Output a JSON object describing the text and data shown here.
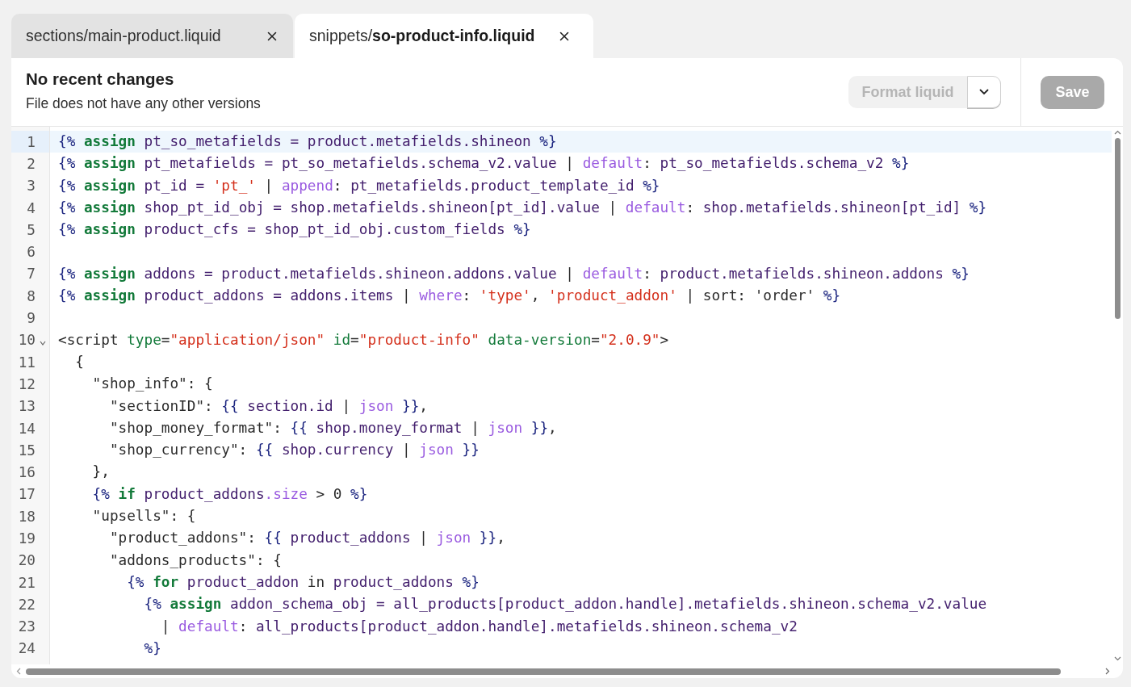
{
  "tabs": [
    {
      "label": "sections/main-product.liquid",
      "selected": false
    },
    {
      "label": "snippets/**so-product-info.liquid**",
      "selected": true
    }
  ],
  "header": {
    "title": "No recent changes",
    "subtitle": "File does not have any other versions"
  },
  "format_button": {
    "label": "Format liquid",
    "disabled": true
  },
  "save_button": {
    "label": "Save",
    "disabled": true
  },
  "lines": [
    {
      "number": "1",
      "active": true,
      "foldable": false,
      "tokens": [
        {
          "text": "{% ",
          "kind": "delim"
        },
        {
          "text": "assign",
          "kind": "keyword"
        },
        {
          "text": " pt_so_metafields = product.metafields.shineon ",
          "kind": "variable"
        },
        {
          "text": "%}",
          "kind": "delim"
        }
      ]
    },
    {
      "number": "2",
      "active": false,
      "foldable": false,
      "tokens": [
        {
          "text": "{% ",
          "kind": "delim"
        },
        {
          "text": "assign",
          "kind": "keyword"
        },
        {
          "text": " pt_metafields = pt_so_metafields.schema_v2.value ",
          "kind": "variable"
        },
        {
          "text": "| ",
          "kind": "plain"
        },
        {
          "text": "default",
          "kind": "filter"
        },
        {
          "text": ": ",
          "kind": "plain"
        },
        {
          "text": "pt_so_metafields.schema_v2 ",
          "kind": "variable"
        },
        {
          "text": "%}",
          "kind": "delim"
        }
      ]
    },
    {
      "number": "3",
      "active": false,
      "foldable": false,
      "tokens": [
        {
          "text": "{% ",
          "kind": "delim"
        },
        {
          "text": "assign",
          "kind": "keyword"
        },
        {
          "text": " pt_id = ",
          "kind": "variable"
        },
        {
          "text": "'pt_'",
          "kind": "string"
        },
        {
          "text": " | ",
          "kind": "plain"
        },
        {
          "text": "append",
          "kind": "filter"
        },
        {
          "text": ": ",
          "kind": "plain"
        },
        {
          "text": "pt_metafields.product_template_id ",
          "kind": "variable"
        },
        {
          "text": "%}",
          "kind": "delim"
        }
      ]
    },
    {
      "number": "4",
      "active": false,
      "foldable": false,
      "tokens": [
        {
          "text": "{% ",
          "kind": "delim"
        },
        {
          "text": "assign",
          "kind": "keyword"
        },
        {
          "text": " shop_pt_id_obj = shop.metafields.shineon[pt_id].value ",
          "kind": "variable"
        },
        {
          "text": "| ",
          "kind": "plain"
        },
        {
          "text": "default",
          "kind": "filter"
        },
        {
          "text": ": ",
          "kind": "plain"
        },
        {
          "text": "shop.metafields.shineon[pt_id] ",
          "kind": "variable"
        },
        {
          "text": "%}",
          "kind": "delim"
        }
      ]
    },
    {
      "number": "5",
      "active": false,
      "foldable": false,
      "tokens": [
        {
          "text": "{% ",
          "kind": "delim"
        },
        {
          "text": "assign",
          "kind": "keyword"
        },
        {
          "text": " product_cfs = shop_pt_id_obj.custom_fields ",
          "kind": "variable"
        },
        {
          "text": "%}",
          "kind": "delim"
        }
      ]
    },
    {
      "number": "6",
      "active": false,
      "foldable": false
    },
    {
      "number": "7",
      "active": false,
      "foldable": false,
      "tokens": [
        {
          "text": "{% ",
          "kind": "delim"
        },
        {
          "text": "assign",
          "kind": "keyword"
        },
        {
          "text": " addons = product.metafields.shineon.addons.value ",
          "kind": "variable"
        },
        {
          "text": "| ",
          "kind": "plain"
        },
        {
          "text": "default",
          "kind": "filter"
        },
        {
          "text": ": ",
          "kind": "plain"
        },
        {
          "text": "product.metafields.shineon.addons ",
          "kind": "variable"
        },
        {
          "text": "%}",
          "kind": "delim"
        }
      ]
    },
    {
      "number": "8",
      "active": false,
      "foldable": false,
      "tokens": [
        {
          "text": "{% ",
          "kind": "delim"
        },
        {
          "text": "assign",
          "kind": "keyword"
        },
        {
          "text": " product_addons = addons.items ",
          "kind": "variable"
        },
        {
          "text": "| ",
          "kind": "plain"
        },
        {
          "text": "where",
          "kind": "filter"
        },
        {
          "text": ": ",
          "kind": "plain"
        },
        {
          "text": "'type'",
          "kind": "string"
        },
        {
          "text": ", ",
          "kind": "plain"
        },
        {
          "text": "'product_addon'",
          "kind": "string"
        },
        {
          "text": " | sort: 'order' ",
          "kind": "plain"
        },
        {
          "text": "%}",
          "kind": "delim"
        }
      ]
    },
    {
      "number": "9",
      "active": false,
      "foldable": false
    },
    {
      "number": "10",
      "active": false,
      "foldable": true,
      "tokens": [
        {
          "text": "<script ",
          "kind": "plain"
        },
        {
          "text": "type",
          "kind": "attr"
        },
        {
          "text": "=",
          "kind": "plain"
        },
        {
          "text": "\"application/json\"",
          "kind": "string"
        },
        {
          "text": " id",
          "kind": "attr"
        },
        {
          "text": "=",
          "kind": "plain"
        },
        {
          "text": "\"product-info\"",
          "kind": "string"
        },
        {
          "text": " data-version",
          "kind": "attr"
        },
        {
          "text": "=",
          "kind": "plain"
        },
        {
          "text": "\"2.0.9\"",
          "kind": "string"
        },
        {
          "text": ">",
          "kind": "plain"
        }
      ]
    },
    {
      "number": "11",
      "active": false,
      "foldable": false,
      "tokens": [
        {
          "text": "  {",
          "kind": "plain"
        }
      ]
    },
    {
      "number": "12",
      "active": false,
      "foldable": false,
      "tokens": [
        {
          "text": "    \"shop_info\": {",
          "kind": "plain"
        }
      ]
    },
    {
      "number": "13",
      "active": false,
      "foldable": false,
      "tokens": [
        {
          "text": "      \"sectionID\": ",
          "kind": "plain"
        },
        {
          "text": "{{ ",
          "kind": "delim"
        },
        {
          "text": "section.id ",
          "kind": "variable"
        },
        {
          "text": "| ",
          "kind": "plain"
        },
        {
          "text": "json",
          "kind": "filter"
        },
        {
          "text": " }}",
          "kind": "delim"
        },
        {
          "text": ",",
          "kind": "plain"
        }
      ]
    },
    {
      "number": "14",
      "active": false,
      "foldable": false,
      "tokens": [
        {
          "text": "      \"shop_money_format\": ",
          "kind": "plain"
        },
        {
          "text": "{{ ",
          "kind": "delim"
        },
        {
          "text": "shop.money_format ",
          "kind": "variable"
        },
        {
          "text": "| ",
          "kind": "plain"
        },
        {
          "text": "json",
          "kind": "filter"
        },
        {
          "text": " }}",
          "kind": "delim"
        },
        {
          "text": ",",
          "kind": "plain"
        }
      ]
    },
    {
      "number": "15",
      "active": false,
      "foldable": false,
      "tokens": [
        {
          "text": "      \"shop_currency\": ",
          "kind": "plain"
        },
        {
          "text": "{{ ",
          "kind": "delim"
        },
        {
          "text": "shop.currency ",
          "kind": "variable"
        },
        {
          "text": "| ",
          "kind": "plain"
        },
        {
          "text": "json",
          "kind": "filter"
        },
        {
          "text": " }}",
          "kind": "delim"
        }
      ]
    },
    {
      "number": "16",
      "active": false,
      "foldable": false,
      "tokens": [
        {
          "text": "    },",
          "kind": "plain"
        }
      ]
    },
    {
      "number": "17",
      "active": false,
      "foldable": false,
      "tokens": [
        {
          "text": "    {% ",
          "kind": "delim"
        },
        {
          "text": "if",
          "kind": "keyword"
        },
        {
          "text": " product_addons",
          "kind": "variable"
        },
        {
          "text": ".size",
          "kind": "filter"
        },
        {
          "text": " > 0 ",
          "kind": "plain"
        },
        {
          "text": "%}",
          "kind": "delim"
        }
      ]
    },
    {
      "number": "18",
      "active": false,
      "foldable": false,
      "tokens": [
        {
          "text": "    \"upsells\": {",
          "kind": "plain"
        }
      ]
    },
    {
      "number": "19",
      "active": false,
      "foldable": false,
      "tokens": [
        {
          "text": "      \"product_addons\": ",
          "kind": "plain"
        },
        {
          "text": "{{ ",
          "kind": "delim"
        },
        {
          "text": "product_addons ",
          "kind": "variable"
        },
        {
          "text": "| ",
          "kind": "plain"
        },
        {
          "text": "json",
          "kind": "filter"
        },
        {
          "text": " }}",
          "kind": "delim"
        },
        {
          "text": ",",
          "kind": "plain"
        }
      ]
    },
    {
      "number": "20",
      "active": false,
      "foldable": false,
      "tokens": [
        {
          "text": "      \"addons_products\": {",
          "kind": "plain"
        }
      ]
    },
    {
      "number": "21",
      "active": false,
      "foldable": false,
      "tokens": [
        {
          "text": "        {% ",
          "kind": "delim"
        },
        {
          "text": "for",
          "kind": "keyword"
        },
        {
          "text": " product_addon ",
          "kind": "variable"
        },
        {
          "text": "in",
          "kind": "plain"
        },
        {
          "text": " product_addons ",
          "kind": "variable"
        },
        {
          "text": "%}",
          "kind": "delim"
        }
      ]
    },
    {
      "number": "22",
      "active": false,
      "foldable": false,
      "tokens": [
        {
          "text": "          {% ",
          "kind": "delim"
        },
        {
          "text": "assign",
          "kind": "keyword"
        },
        {
          "text": " addon_schema_obj = all_products[product_addon.handle].metafields.shineon.schema_v2.value",
          "kind": "variable"
        }
      ]
    },
    {
      "number": "23",
      "active": false,
      "foldable": false,
      "tokens": [
        {
          "text": "            | ",
          "kind": "plain"
        },
        {
          "text": "default",
          "kind": "filter"
        },
        {
          "text": ": ",
          "kind": "plain"
        },
        {
          "text": "all_products[product_addon.handle].metafields.shineon.schema_v2",
          "kind": "variable"
        }
      ]
    },
    {
      "number": "24",
      "active": false,
      "foldable": false,
      "tokens": [
        {
          "text": "          %}",
          "kind": "delim"
        }
      ]
    }
  ]
}
